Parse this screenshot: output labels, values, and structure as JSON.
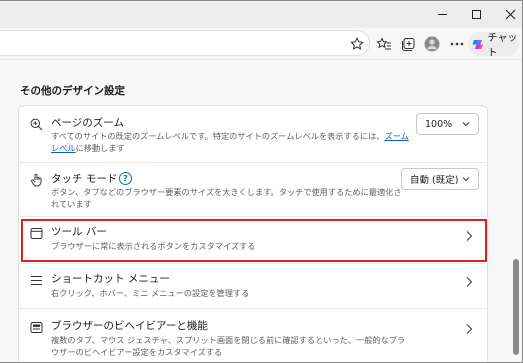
{
  "toolbar": {
    "chat_label": "チャット"
  },
  "section": {
    "title": "その他のデザイン設定"
  },
  "settings": {
    "zoom": {
      "title": "ページのズーム",
      "desc_prefix": "すべてのサイトの既定のズームレベルです。特定のサイトのズームレベルを表示するには、",
      "desc_link": "ズーム レベル",
      "desc_suffix": "に移動します",
      "value": "100%"
    },
    "touch": {
      "title": "タッチ モード",
      "help": "?",
      "desc": "ボタン、タブなどのブラウザー要素のサイズを大きくします。タッチで使用するために最適化されています",
      "value": "自動 (既定)"
    },
    "toolbar_item": {
      "title": "ツール バー",
      "desc": "ブラウザーに常に表示されるボタンをカスタマイズする"
    },
    "shortcut": {
      "title": "ショートカット メニュー",
      "desc": "右クリック、ホバー、ミニ メニューの設定を管理する"
    },
    "behavior": {
      "title": "ブラウザーのビヘイビアーと機能",
      "desc": "複数のタブ、マウス ジェスチャ、スプリット画面を閉じる前に確認するといった、一般的なブラウザーのビヘイビアー設定をカスタマイズする"
    }
  },
  "colors": {
    "accent": "#0f6cbd",
    "highlight": "#d62323"
  }
}
